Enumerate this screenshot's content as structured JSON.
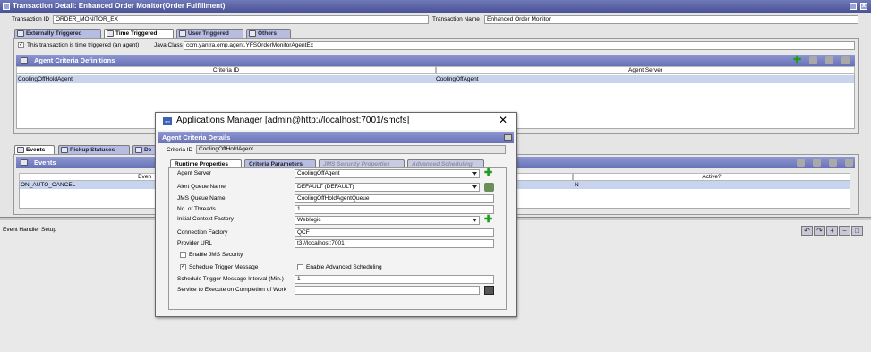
{
  "window": {
    "title": "Transaction Detail: Enhanced Order Monitor(Order Fulfillment)"
  },
  "transaction": {
    "id_label": "Transaction ID",
    "id_value": "ORDER_MONITOR_EX",
    "name_label": "Transaction Name",
    "name_value": "Enhanced Order Monitor"
  },
  "trigger_tabs": [
    {
      "label": "Externally Triggered"
    },
    {
      "label": "Time Triggered"
    },
    {
      "label": "User Triggered"
    },
    {
      "label": "Others"
    }
  ],
  "time_triggered": {
    "checkbox_label": "This transaction is time triggered (an agent)",
    "checked": true,
    "java_class_label": "Java Class",
    "java_class_value": "com.yantra.omp.agent.YFSOrderMonitorAgentEx"
  },
  "agent_criteria": {
    "title": "Agent Criteria Definitions",
    "columns": [
      "Criteria ID",
      "Agent Server"
    ],
    "rows": [
      [
        "CoolingOffHoldAgent",
        "CoolingOffAgent"
      ]
    ]
  },
  "lower_tabs": [
    {
      "label": "Events"
    },
    {
      "label": "Pickup Statuses"
    },
    {
      "label": "De"
    }
  ],
  "events": {
    "title": "Events",
    "columns": [
      "Even",
      "Active?"
    ],
    "rows": [
      [
        "ON_AUTO_CANCEL",
        "N"
      ]
    ]
  },
  "event_handler_label": "Event Handler Setup",
  "dialog": {
    "title": "Applications Manager [admin@http://localhost:7001/smcfs]",
    "panel_title": "Agent Criteria Details",
    "criteria_id_label": "Criteria ID",
    "criteria_id_value": "CoolingOffHoldAgent",
    "tabs": [
      {
        "label": "Runtime Properties"
      },
      {
        "label": "Criteria Parameters"
      },
      {
        "label": "JMS Security Properties"
      },
      {
        "label": "Advanced Scheduling"
      }
    ],
    "agent_server_label": "Agent Server",
    "agent_server_value": "CoolingOffAgent",
    "alert_queue_label": "Alert Queue Name",
    "alert_queue_value": "DEFAULT (DEFAULT)",
    "jms_queue_label": "JMS Queue Name",
    "jms_queue_value": "CoolingOffHoldAgentQueue",
    "threads_label": "No. of Threads",
    "threads_value": "1",
    "context_factory_label": "Initial Context Factory",
    "context_factory_value": "Weblogic",
    "connection_factory_label": "Connection Factory",
    "connection_factory_value": "QCF",
    "provider_url_label": "Provider URL",
    "provider_url_value": "t3://localhost:7001",
    "enable_jms_label": "Enable JMS Security",
    "enable_jms_checked": false,
    "schedule_trigger_label": "Schedule Trigger Message",
    "schedule_trigger_checked": true,
    "advanced_sched_label": "Enable Advanced Scheduling",
    "advanced_sched_checked": false,
    "interval_label": "Schedule Trigger Message Interval (Min.)",
    "interval_value": "1",
    "service_label": "Service to Execute on Completion of Work",
    "service_value": ""
  }
}
